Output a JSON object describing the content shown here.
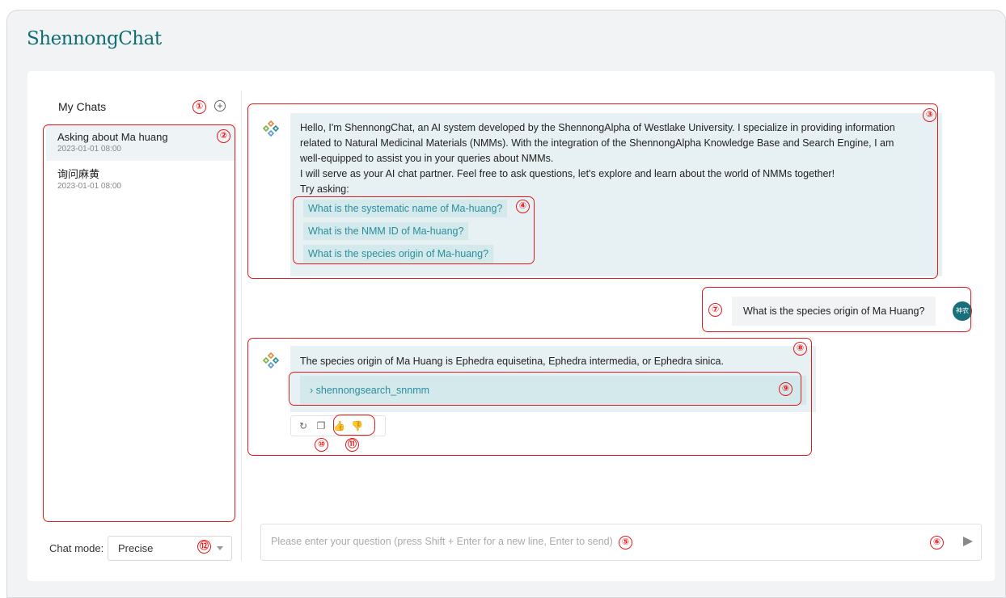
{
  "app": {
    "brand": "ShennongChat"
  },
  "sidebar": {
    "title": "My Chats",
    "chats": [
      {
        "title": "Asking about Ma huang",
        "date": "2023-01-01 08:00"
      },
      {
        "title": "询问麻黄",
        "date": "2023-01-01 08:00"
      }
    ],
    "mode_label": "Chat mode:",
    "mode_value": "Precise"
  },
  "conversation": {
    "welcome": {
      "line1": "Hello, I'm ShennongChat, an AI system developed by the ShennongAlpha of Westlake University. I specialize in providing information",
      "line2": "related to Natural Medicinal Materials (NMMs). With the integration of the ShennongAlpha Knowledge Base and Search Engine, I am",
      "line3": "well-equipped to assist you in your queries about NMMs.",
      "line4": "I will serve as your AI chat partner. Feel free to ask questions, let's explore and learn about the world of NMMs together!",
      "try": "Try asking:",
      "suggestions": [
        "What is the systematic name of Ma-huang?",
        "What is the NMM ID of Ma-huang?",
        "What is the species origin of Ma-huang?"
      ]
    },
    "user_message": "What is the species origin of Ma Huang?",
    "user_avatar_text": "神农",
    "answer": "The species origin of Ma Huang is Ephedra equisetina, Ephedra intermedia, or Ephedra sinica.",
    "tool_call": "shennongsearch_snnmm"
  },
  "input": {
    "placeholder": "Please enter your question (press Shift + Enter for a new line, Enter to send)"
  },
  "annotations": [
    "①",
    "②",
    "③",
    "④",
    "⑤",
    "⑥",
    "⑦",
    "⑧",
    "⑨",
    "⑩",
    "⑪",
    "⑫"
  ],
  "colors": {
    "brand": "#0f6f70",
    "bubble": "#e7f1f3",
    "suggestion_text": "#2a8f9a",
    "annotation": "#e31a1a"
  }
}
